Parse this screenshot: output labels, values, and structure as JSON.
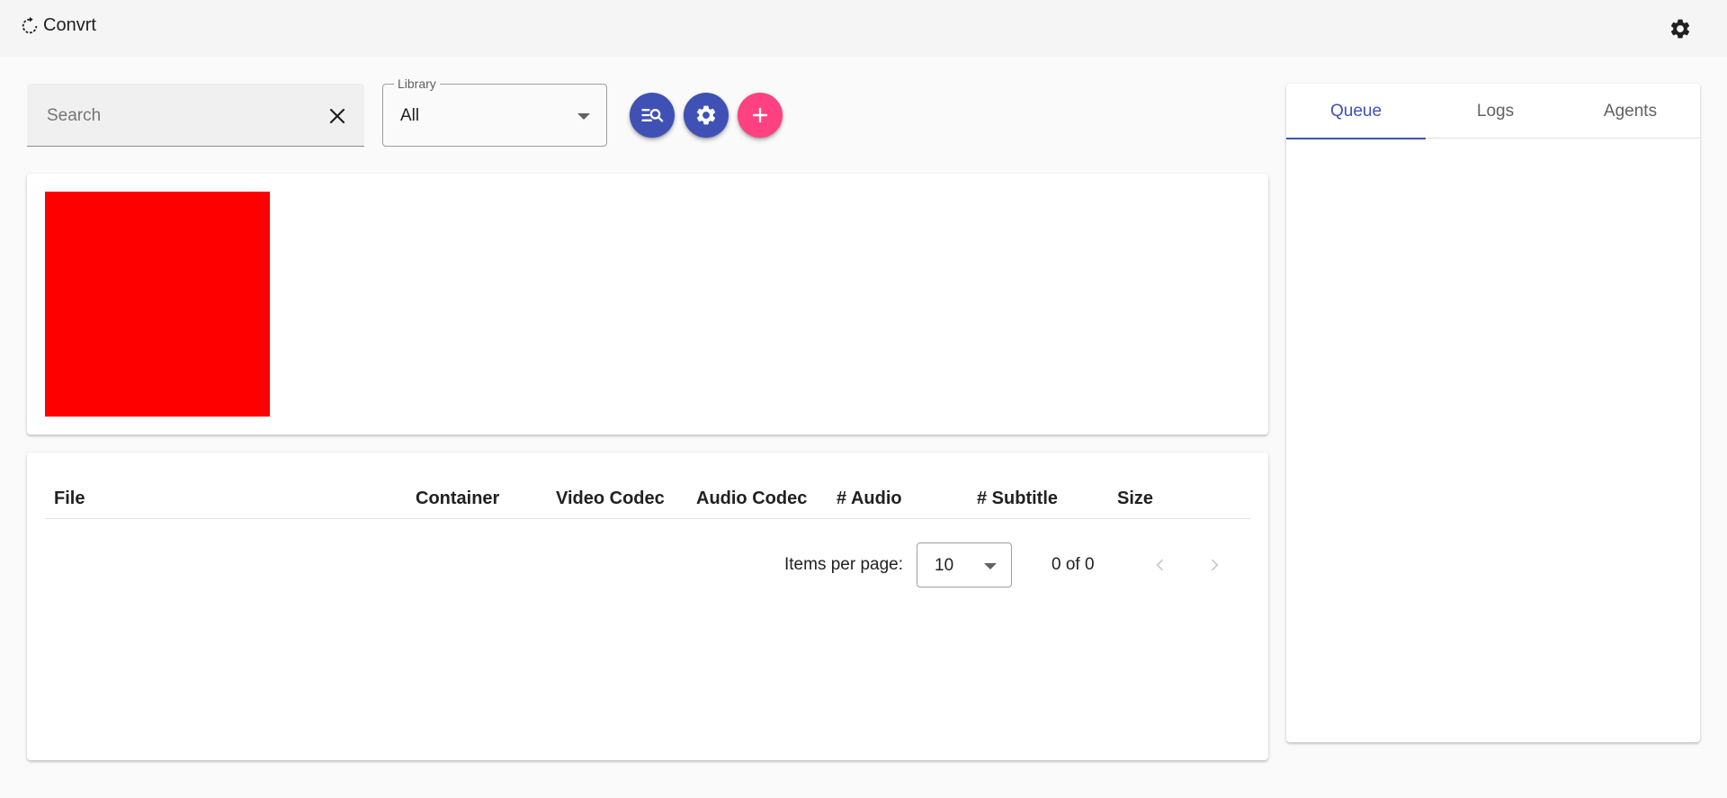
{
  "app": {
    "title": "Convrt"
  },
  "search": {
    "placeholder": "Search",
    "value": ""
  },
  "library": {
    "label": "Library",
    "selected": "All"
  },
  "table": {
    "columns": [
      "File",
      "Container",
      "Video Codec",
      "Audio Codec",
      "# Audio",
      "# Subtitle",
      "Size"
    ],
    "rows": []
  },
  "paginator": {
    "items_per_page_label": "Items per page:",
    "items_per_page": "10",
    "range_label": "0 of 0"
  },
  "side_panel": {
    "tabs": [
      {
        "label": "Queue",
        "active": true
      },
      {
        "label": "Logs",
        "active": false
      },
      {
        "label": "Agents",
        "active": false
      }
    ]
  },
  "colors": {
    "primary": "#3f51b5",
    "accent": "#ff4081",
    "preview": "#ff0000"
  },
  "icons": {
    "brand": "autorenew-icon",
    "settings": "gear-icon",
    "clear": "close-icon",
    "scan": "manage-search-icon",
    "add": "plus-icon"
  }
}
